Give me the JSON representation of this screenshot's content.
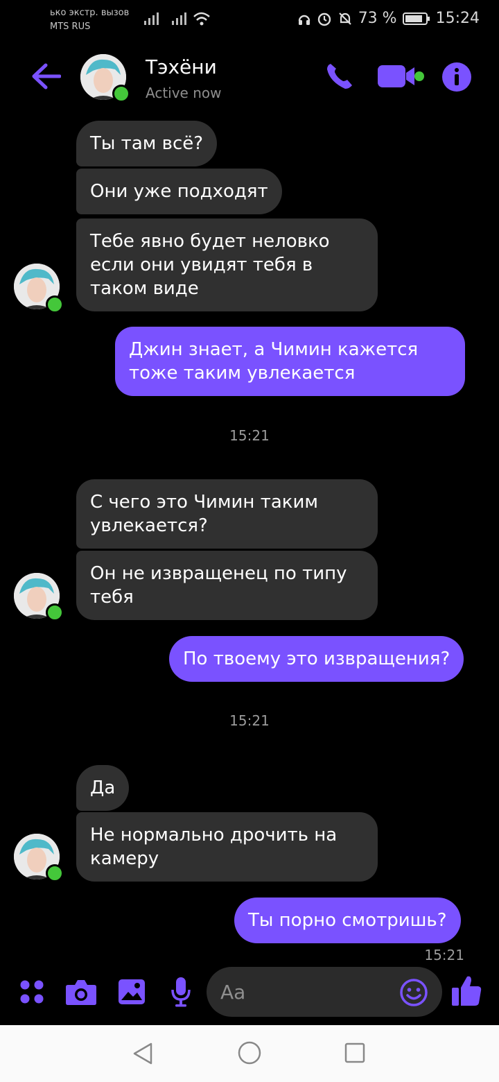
{
  "status_bar": {
    "carrier_line1": "ько экстр. вызов",
    "carrier_line2": "MTS RUS",
    "battery": "73 %",
    "time": "15:24"
  },
  "header": {
    "contact_name": "Тэхёни",
    "presence": "Active now"
  },
  "messages": [
    {
      "from": "them",
      "text": "Ты там всё?"
    },
    {
      "from": "them",
      "text": "Они уже подходят"
    },
    {
      "from": "them",
      "text": "Тебе явно будет неловко\nесли они увидят тебя в\nтаком виде"
    },
    {
      "from": "me",
      "text": "Джин знает, а Чимин кажется\nтоже таким увлекается"
    },
    {
      "from": "them",
      "text": "С чего это Чимин таким\nувлекается?"
    },
    {
      "from": "them",
      "text": "Он не извращенец по типу\nтебя"
    },
    {
      "from": "me",
      "text": "По твоему это извращения?"
    },
    {
      "from": "them",
      "text": "Да"
    },
    {
      "from": "them",
      "text": "Не нормально дрочить на\nкамеру"
    },
    {
      "from": "me",
      "text": "Ты порно смотришь?"
    }
  ],
  "timestamps": [
    "15:21",
    "15:21",
    "15:21"
  ],
  "composer": {
    "placeholder": "Aa"
  },
  "colors": {
    "accent": "#7a52ff",
    "incoming_bubble": "#303030",
    "online": "#44c73a"
  },
  "icons": [
    "back-arrow-icon",
    "phone-icon",
    "video-icon",
    "info-icon",
    "apps-icon",
    "camera-icon",
    "gallery-icon",
    "mic-icon",
    "emoji-icon",
    "thumbs-up-icon"
  ]
}
